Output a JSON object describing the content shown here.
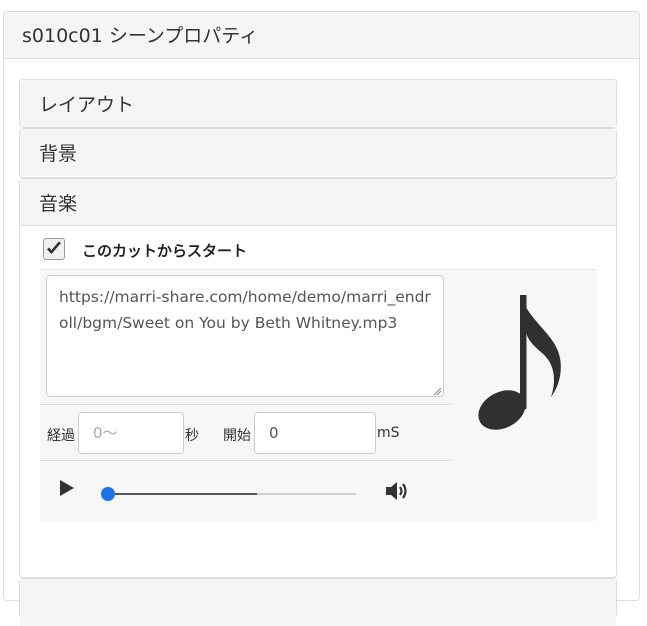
{
  "panel": {
    "title": "s010c01 シーンプロパティ"
  },
  "sections": {
    "layout": "レイアウト",
    "background": "背景",
    "music": "音楽"
  },
  "music": {
    "start_from_this_cut": {
      "label": "このカットからスタート",
      "checked": true
    },
    "url": "https://marri-share.com/home/demo/marri_endroll/bgm/Sweet on You by Beth Whitney.mp3",
    "elapsed": {
      "label": "経過",
      "placeholder": "0〜",
      "unit": "秒"
    },
    "start": {
      "label": "開始",
      "value": "0",
      "unit": "mS"
    },
    "player": {
      "progress_fraction": 0.6
    }
  },
  "icons": {
    "checkmark": "checkmark-icon",
    "play": "play-icon",
    "volume": "volume-icon",
    "note": "music-note-icon"
  }
}
